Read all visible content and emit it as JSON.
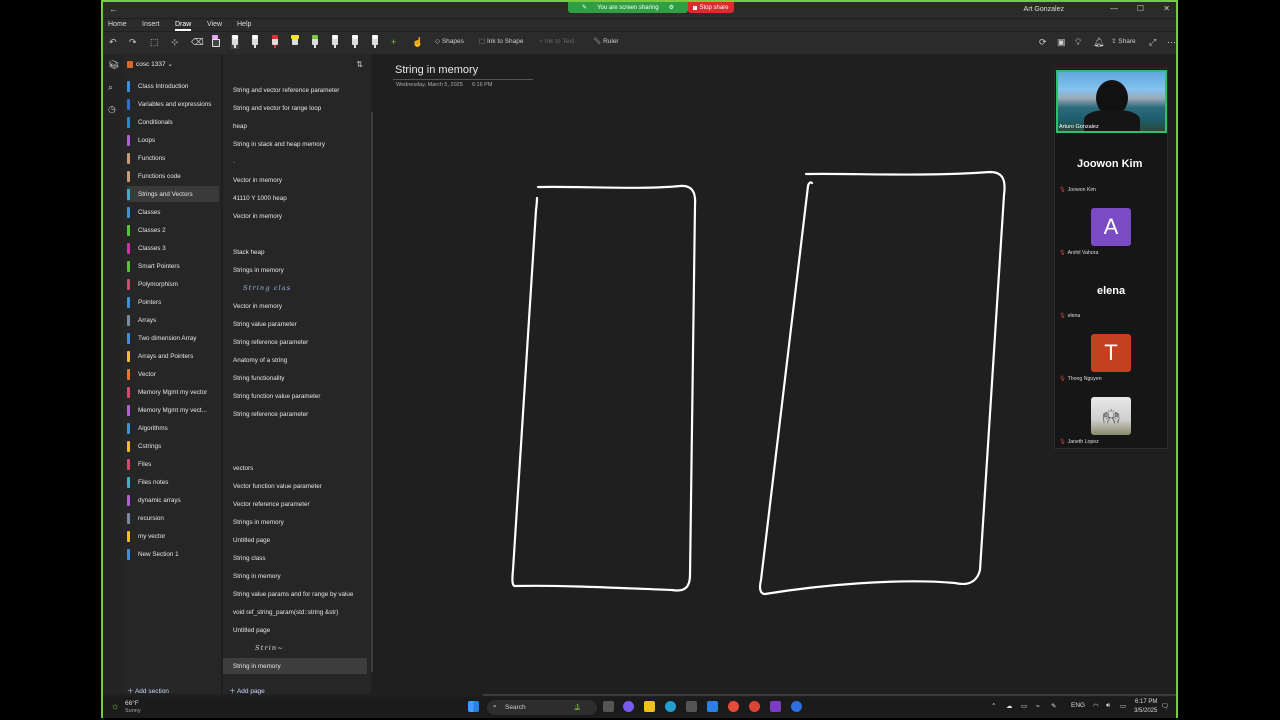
{
  "titlebar": {
    "back": "←",
    "sharing_notice": "You are screen sharing",
    "stop_share": "Stop share",
    "user": "Art Gonzalez",
    "minimize": "—",
    "maximize": "☐",
    "close": "✕"
  },
  "menu": {
    "items": [
      "Home",
      "Insert",
      "Draw",
      "View",
      "Help"
    ],
    "active": "Draw"
  },
  "toolbar": {
    "shapes": "Shapes",
    "ink_to_shape": "Ink to Shape",
    "ink_to_text": "Ink to Text",
    "ruler": "Ruler",
    "share": "Share",
    "pen_colors": [
      "#e9a7ff",
      "#ffffff",
      "#ffffff",
      "#e03030",
      "#f5e32a",
      "#ffffff",
      "#ffffff",
      "#ffffff",
      "#ffffff"
    ]
  },
  "notebook": {
    "title": "cosc 1337"
  },
  "sections": [
    {
      "label": "Class Introduction",
      "color": "#3f8fe0"
    },
    {
      "label": "Variables and expressions",
      "color": "#2f6fd6"
    },
    {
      "label": "Conditionals",
      "color": "#1a8fd1"
    },
    {
      "label": "Loops",
      "color": "#b05fd6"
    },
    {
      "label": "Functions",
      "color": "#c99b7a"
    },
    {
      "label": "Functions code",
      "color": "#c99b7a"
    },
    {
      "label": "Strings and Vectors",
      "color": "#39b4c4"
    },
    {
      "label": "Classes",
      "color": "#3f8fe0"
    },
    {
      "label": "Classes 2",
      "color": "#58c43a"
    },
    {
      "label": "Classes 3",
      "color": "#d62fa8"
    },
    {
      "label": "Smart Pointers",
      "color": "#58c43a"
    },
    {
      "label": "Polymorphism",
      "color": "#d6486e"
    },
    {
      "label": "Pointers",
      "color": "#3f8fe0"
    },
    {
      "label": "Arrays",
      "color": "#7a8aa0"
    },
    {
      "label": "Two dimension Array",
      "color": "#3f8fe0"
    },
    {
      "label": "Arrays and Pointers",
      "color": "#f0c020"
    },
    {
      "label": "Vector",
      "color": "#f07030"
    },
    {
      "label": "Memory Mgmt my vector",
      "color": "#d6486e"
    },
    {
      "label": "Memory Mgmt my vect...",
      "color": "#b05fd6"
    },
    {
      "label": "Algorithms",
      "color": "#3f8fe0"
    },
    {
      "label": "Cstrings",
      "color": "#f0c020"
    },
    {
      "label": "Files",
      "color": "#d6486e"
    },
    {
      "label": "Files notes",
      "color": "#39b4c4"
    },
    {
      "label": "dynamic arrays",
      "color": "#b05fd6"
    },
    {
      "label": "recursion",
      "color": "#7a8aa0"
    },
    {
      "label": "my vector",
      "color": "#f0c020"
    },
    {
      "label": "New Section 1",
      "color": "#3f8fe0"
    }
  ],
  "selected_section": "Strings and Vectors",
  "add_section": "Add section",
  "pages": [
    {
      "label": "String and vector reference parameter",
      "kind": "text"
    },
    {
      "label": "String and vector for range loop",
      "kind": "text"
    },
    {
      "label": "heap",
      "kind": "text"
    },
    {
      "label": "String in stack and heap memory",
      "kind": "text"
    },
    {
      "label": "·",
      "kind": "text"
    },
    {
      "label": "Vector in memory",
      "kind": "text"
    },
    {
      "label": "41110 Y 1000 heap",
      "kind": "text"
    },
    {
      "label": "Vector in memory",
      "kind": "text"
    },
    {
      "label": "",
      "kind": "text"
    },
    {
      "label": "Stack heap",
      "kind": "text"
    },
    {
      "label": "Strings in memory",
      "kind": "text"
    },
    {
      "label": "String clas",
      "kind": "ink"
    },
    {
      "label": "Vector in memory",
      "kind": "text"
    },
    {
      "label": "String value parameter",
      "kind": "text"
    },
    {
      "label": "String reference parameter",
      "kind": "text"
    },
    {
      "label": "Anatomy of a string",
      "kind": "text"
    },
    {
      "label": "String functionality",
      "kind": "text"
    },
    {
      "label": "String function value parameter",
      "kind": "text"
    },
    {
      "label": "String reference parameter",
      "kind": "text"
    },
    {
      "label": "",
      "kind": "text"
    },
    {
      "label": "",
      "kind": "text"
    },
    {
      "label": "vectors",
      "kind": "text"
    },
    {
      "label": "Vector function value parameter",
      "kind": "text"
    },
    {
      "label": "Vector reference parameter",
      "kind": "text"
    },
    {
      "label": "Strings in memory",
      "kind": "text"
    },
    {
      "label": "Untitled page",
      "kind": "text"
    },
    {
      "label": "String class",
      "kind": "text"
    },
    {
      "label": "String in memory",
      "kind": "text"
    },
    {
      "label": "String value params and for range by value",
      "kind": "text"
    },
    {
      "label": "void ref_string_param(std::string &str)",
      "kind": "text"
    },
    {
      "label": "Untitled page",
      "kind": "text"
    },
    {
      "label": "Strin~",
      "kind": "ink2"
    },
    {
      "label": "String in memory",
      "kind": "text"
    }
  ],
  "selected_page_index": 32,
  "add_page": "Add page",
  "page": {
    "title": "String in memory",
    "date": "Wednesday, March 5, 2025",
    "time": "6:16 PM"
  },
  "participants": {
    "video_name": "Arturo Gonzalez",
    "people": [
      {
        "display": "Joowon Kim",
        "name": "Joowon Kim",
        "type": "text"
      },
      {
        "display": "A",
        "name": "Arshil Vahora",
        "type": "avatar",
        "color": "#7b4bc4"
      },
      {
        "display": "elena",
        "name": "elena",
        "type": "text"
      },
      {
        "display": "T",
        "name": "Thong Nguyen",
        "type": "avatar",
        "color": "#c4401f"
      },
      {
        "display": "",
        "name": "Janeth Lopez",
        "type": "photo"
      }
    ]
  },
  "taskbar": {
    "weather_temp": "66°F",
    "weather_desc": "Sunny",
    "search": "Search",
    "lang": "ENG",
    "time": "6:17 PM",
    "date": "3/5/2025"
  }
}
